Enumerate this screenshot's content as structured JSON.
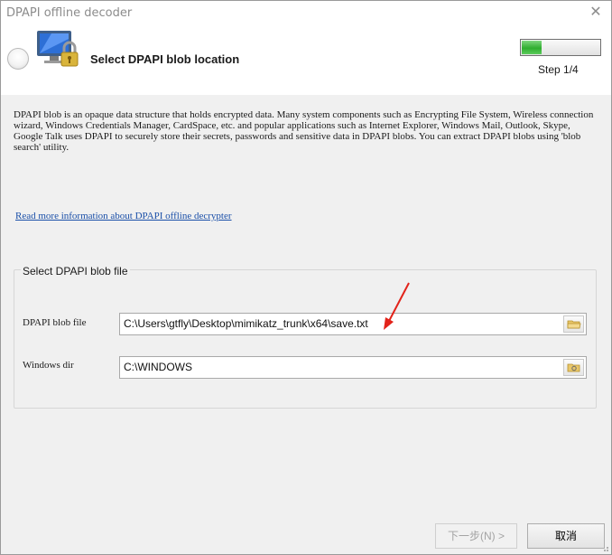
{
  "window": {
    "title": "DPAPI offline decoder",
    "close_glyph": "✕"
  },
  "header": {
    "title": "Select DPAPI blob location",
    "step_label": "Step 1/4",
    "progress_fraction": 0.25,
    "logo_icon": "monitor-lock-icon"
  },
  "body": {
    "description": "DPAPI blob is an opaque data structure that holds encrypted data. Many system components such as Encrypting File System, Wireless connection wizard, Windows Credentials Manager, CardSpace, etc. and popular applications such as Internet Explorer, Windows Mail, Outlook, Skype, Google Talk uses DPAPI to securely store their secrets, passwords and sensitive data in DPAPI blobs. You can extract DPAPI blobs using 'blob search' utility.",
    "link_text": "Read more information about DPAPI offline decrypter"
  },
  "group": {
    "title": "Select DPAPI blob file",
    "blob_file_label": "DPAPI blob file",
    "blob_file_value": "C:\\Users\\gtfly\\Desktop\\mimikatz_trunk\\x64\\save.txt",
    "windows_dir_label": "Windows dir",
    "windows_dir_value": "C:\\WINDOWS"
  },
  "footer": {
    "next_label": "下一步(N) >",
    "cancel_label": "取消"
  },
  "colors": {
    "progress_green": "#2fae2f",
    "link_blue": "#1a4fa8",
    "annotation_arrow": "#e2231a"
  }
}
